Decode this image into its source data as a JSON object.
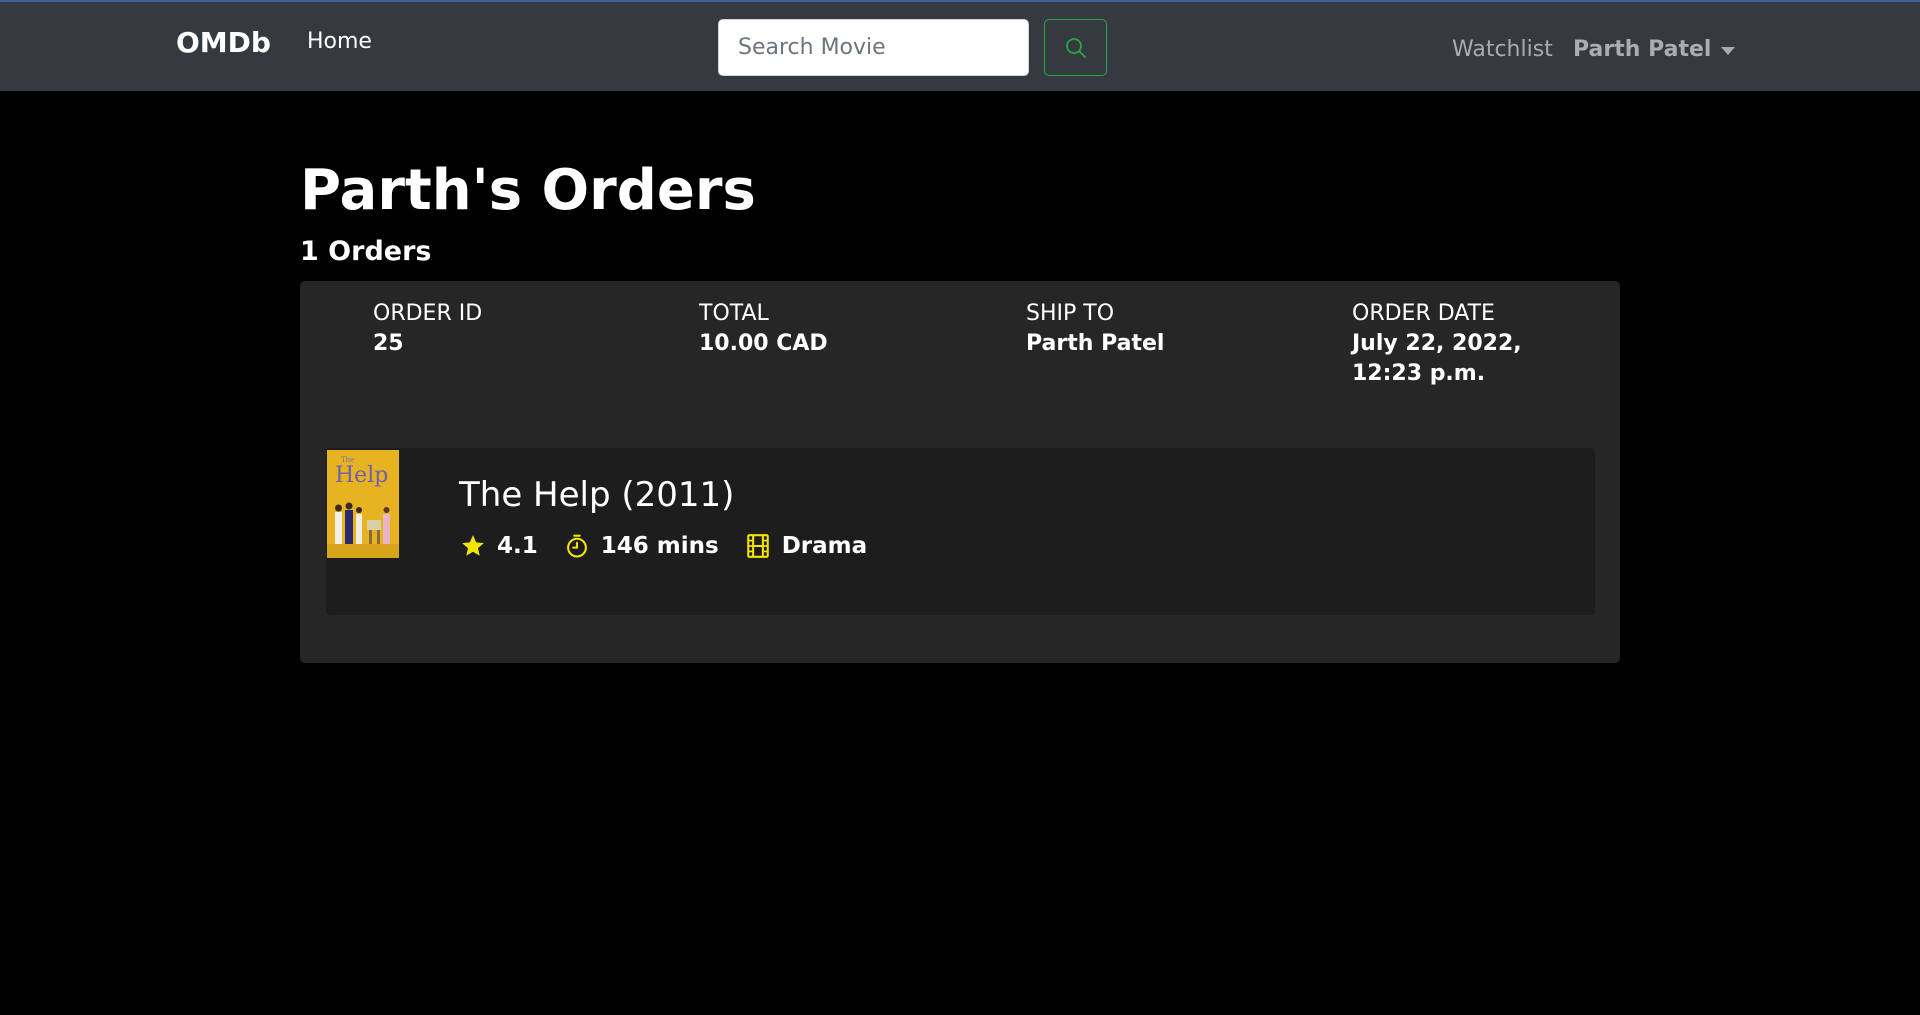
{
  "navbar": {
    "brand": "OMDb",
    "home_label": "Home",
    "search_placeholder": "Search Movie",
    "search_button_icon": "search-icon",
    "watchlist_label": "Watchlist",
    "user_name": "Parth Patel",
    "user_menu_icon": "caret-down-icon"
  },
  "page": {
    "title": "Parth's Orders",
    "order_count": "1 Orders"
  },
  "order": {
    "order_id_label": "ORDER ID",
    "order_id": "25",
    "total_label": "TOTAL",
    "total": "10.00 CAD",
    "ship_to_label": "SHIP TO",
    "ship_to": "Parth Patel",
    "order_date_label": "ORDER DATE",
    "order_date": "July 22, 2022, 12:23 p.m.",
    "items": [
      {
        "title": "The Help (2011)",
        "rating": "4.1",
        "runtime": "146 mins",
        "genre": "Drama",
        "poster_text": "Help",
        "rating_icon": "star-icon",
        "runtime_icon": "stopwatch-icon",
        "genre_icon": "film-icon"
      }
    ]
  },
  "colors": {
    "navbar_bg": "#343a40",
    "page_bg": "#000000",
    "card_bg": "#262626",
    "item_bg": "#1d1d1d",
    "accent_yellow": "#f5e400",
    "search_green": "#28a745",
    "poster_yellow": "#e8b321"
  }
}
